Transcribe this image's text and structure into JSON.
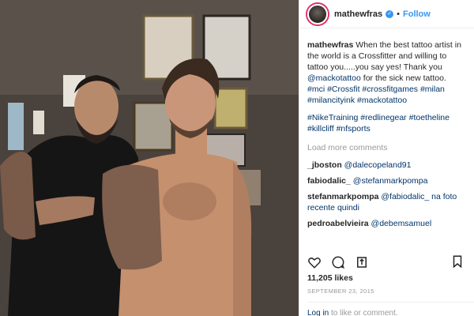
{
  "post": {
    "username": "mathewfras",
    "verified_glyph": "✓",
    "dot": "•",
    "follow_label": "Follow"
  },
  "caption": {
    "username": "mathewfras",
    "text_1": "When the best tattoo artist in the world is a Crossfitter and willing to tattoo you.....you say yes! Thank you ",
    "mention": "@mackotattoo",
    "text_2": " for the sick new tattoo.",
    "hashtags_1": "#mci #Crossfit #crossfitgames #milan #milancityink #mackotattoo",
    "hashtags_2": "#NikeTraining #redlinegear #toetheline #killcliff #nfsports"
  },
  "load_more_label": "Load more comments",
  "comments": [
    {
      "user": "_jboston",
      "text": "@dalecopeland91"
    },
    {
      "user": "fabiodalic_",
      "text": "@stefanmarkpompa"
    },
    {
      "user": "stefanmarkpompa",
      "text": "@fabiodalic_ na foto recente quindi"
    },
    {
      "user": "pedroabelvieira",
      "text": "@debemsamuel"
    }
  ],
  "likes": "11,205 likes",
  "date": "SEPTEMBER 23, 2015",
  "login": {
    "link": "Log in",
    "text": " to like or comment."
  },
  "icons": {
    "like": "heart-icon",
    "comment": "comment-icon",
    "share": "share-icon",
    "save": "bookmark-icon"
  },
  "colors": {
    "accent": "#3897f0",
    "link": "#003569",
    "muted": "#999999"
  }
}
